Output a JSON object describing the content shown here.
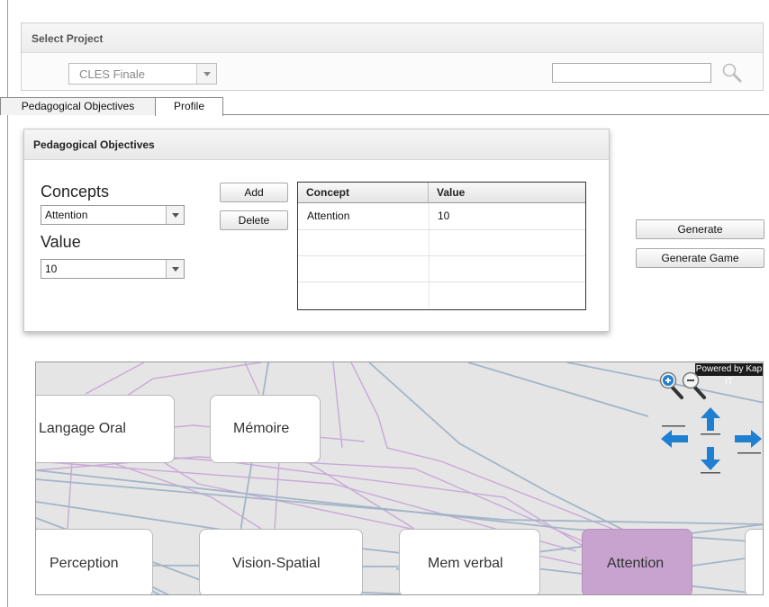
{
  "project_panel": {
    "title": "Select Project",
    "project_value": "CLES Finale",
    "search_value": "",
    "search_placeholder": ""
  },
  "tabs": [
    {
      "label": "Pedagogical Objectives",
      "selected": false
    },
    {
      "label": "Profile",
      "selected": true
    }
  ],
  "objectives": {
    "title": "Pedagogical Objectives",
    "concepts_label": "Concepts",
    "concept_value": "Attention",
    "value_label": "Value",
    "value_value": "10",
    "add_label": "Add",
    "delete_label": "Delete",
    "table": {
      "columns": [
        "Concept",
        "Value"
      ],
      "rows": [
        [
          "Attention",
          "10"
        ]
      ]
    }
  },
  "actions": {
    "generate_label": "Generate",
    "generate_game_label": "Generate Game"
  },
  "graph": {
    "powered_by": "Powered by Kap IT",
    "nodes": [
      "Langage Oral",
      "Mémoire",
      "Perception",
      "Vision-Spatial",
      "Mem verbal",
      "Attention"
    ],
    "selected_node": "Attention",
    "colors": {
      "background": "#e5e5e5",
      "edge_purple": "#c9a9d8",
      "edge_blue": "#9fb2c6",
      "selected_node_fill": "#c8a3cf",
      "nav_arrow": "#1f7fd0"
    }
  }
}
